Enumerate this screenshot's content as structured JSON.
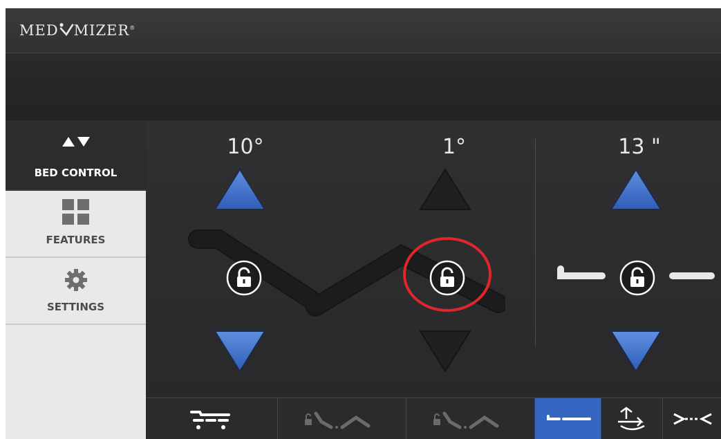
{
  "header": {
    "brand": "MEDIMIZER"
  },
  "sidebar": {
    "items": [
      {
        "label": "BED CONTROL",
        "icon": "up-down-arrows-icon",
        "active": true
      },
      {
        "label": "FEATURES",
        "icon": "grid-icon",
        "active": false
      },
      {
        "label": "SETTINGS",
        "icon": "gear-icon",
        "active": false
      }
    ]
  },
  "controls": {
    "head": {
      "value": "10°"
    },
    "foot": {
      "value": "1°"
    },
    "height": {
      "value": "13 \""
    }
  },
  "bottom_tabs": [
    {
      "icon": "bed-frame-icon",
      "active": false
    },
    {
      "icon": "locked-knee-gatch-icon",
      "active": false
    },
    {
      "icon": "locked-knee-gatch-icon",
      "active": false
    },
    {
      "icon": "flat-bed-icon",
      "active": true
    },
    {
      "icon": "rotate-icon",
      "active": false
    },
    {
      "icon": "compress-icon",
      "active": false
    }
  ],
  "colors": {
    "accent": "#3567c2",
    "highlight_circle": "#e0262b"
  }
}
